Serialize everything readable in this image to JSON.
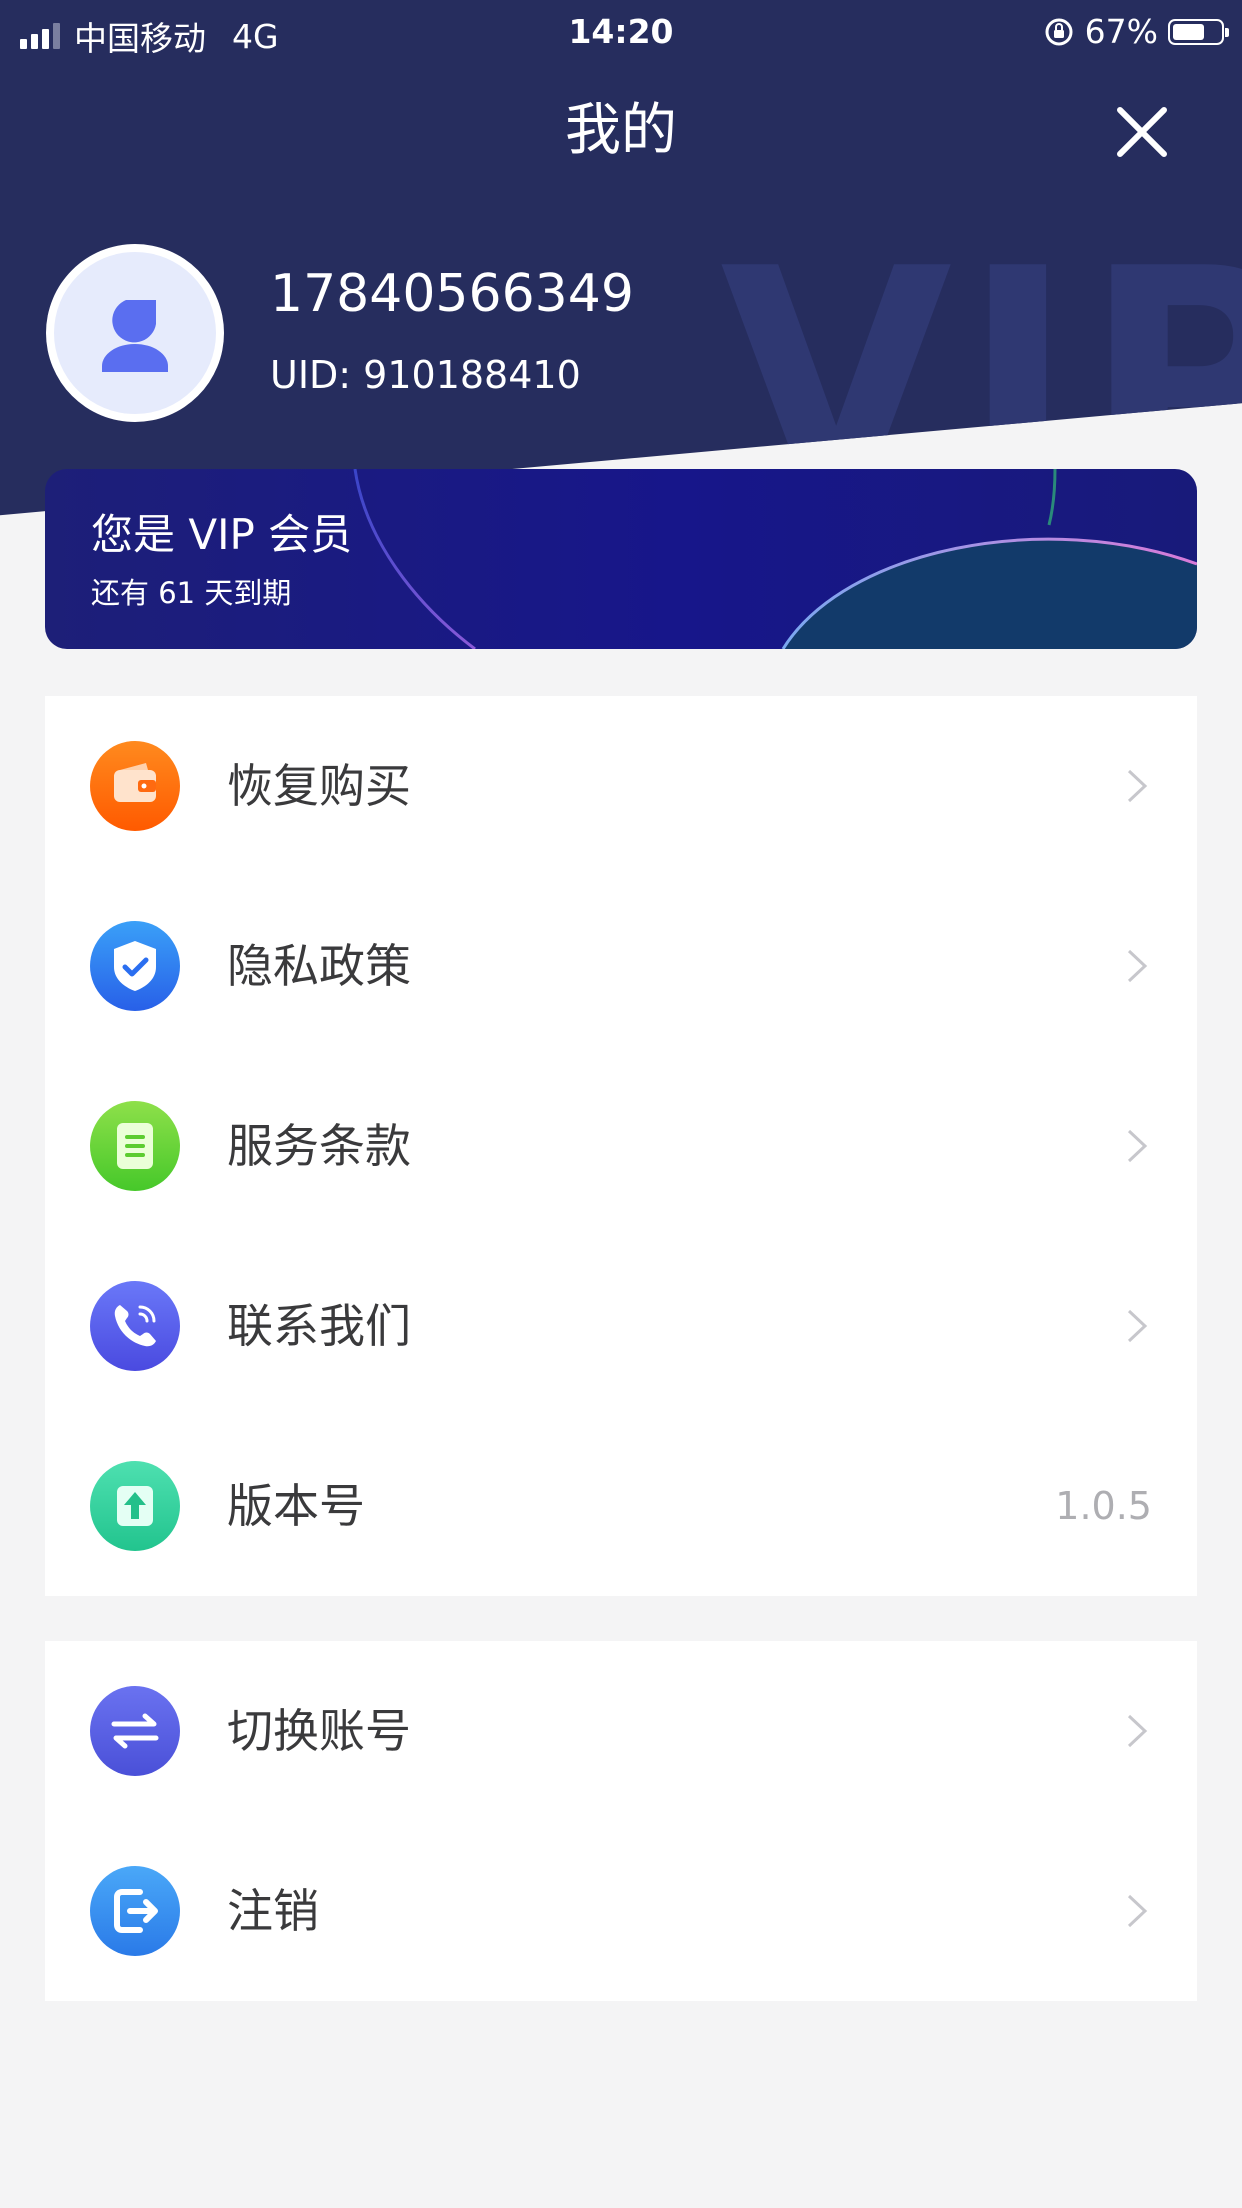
{
  "status_bar": {
    "carrier": "中国移动",
    "network": "4G",
    "time": "14:20",
    "battery_percent": "67%",
    "battery_level": 0.67
  },
  "header": {
    "title": "我的",
    "watermark": "VIP"
  },
  "profile": {
    "phone": "17840566349",
    "uid": "UID: 910188410"
  },
  "vip_card": {
    "title": "您是 VIP 会员",
    "subtitle": "还有 61 天到期"
  },
  "menu_group_1": [
    {
      "label": "恢复购买",
      "icon": "wallet-icon"
    },
    {
      "label": "隐私政策",
      "icon": "shield-check-icon"
    },
    {
      "label": "服务条款",
      "icon": "document-icon"
    },
    {
      "label": "联系我们",
      "icon": "phone-icon"
    },
    {
      "label": "版本号",
      "icon": "upload-arrow-icon",
      "value": "1.0.5"
    }
  ],
  "menu_group_2": [
    {
      "label": "切换账号",
      "icon": "switch-arrows-icon"
    },
    {
      "label": "注销",
      "icon": "logout-icon"
    }
  ],
  "colors": {
    "header_bg": "#262d5e",
    "vip_card_bg": "#17168a",
    "page_bg": "#f4f4f5",
    "icon_orange": "#ff6a00",
    "icon_blue": "#2f7ef0",
    "icon_green": "#5fd23a",
    "icon_purple": "#5a5ff0",
    "icon_teal": "#2fd2a6"
  }
}
